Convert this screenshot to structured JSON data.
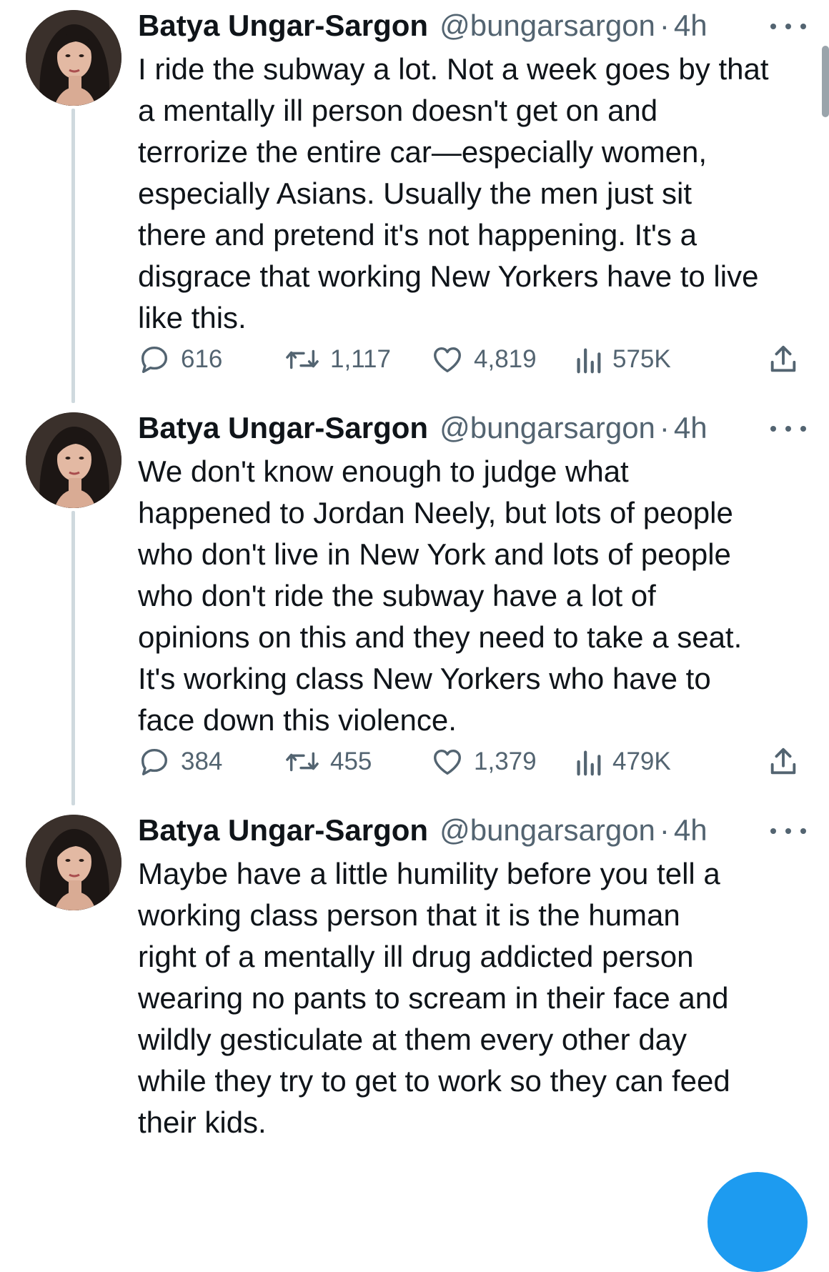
{
  "tweets": [
    {
      "display_name": "Batya Ungar-Sargon",
      "handle": "@bungarsargon",
      "separator": "·",
      "time": "4h",
      "text": "I ride the subway a lot. Not a week goes by that\na  mentally ill person doesn't get on and\nterrorize the entire car—especially women,\nespecially Asians. Usually the men just sit\nthere and pretend it's not happening. It's a\ndisgrace that working New Yorkers have to live\nlike this.",
      "replies": "616",
      "retweets": "1,117",
      "likes": "4,819",
      "views": "575K"
    },
    {
      "display_name": "Batya Ungar-Sargon",
      "handle": "@bungarsargon",
      "separator": "·",
      "time": "4h",
      "text": "We don't know enough to judge what\nhappened to Jordan Neely, but lots of people\nwho don't live in New York and lots of people\nwho don't ride the subway have a lot of\nopinions on this and they need to take a seat.\nIt's working class New Yorkers who have to\nface down this violence.",
      "replies": "384",
      "retweets": "455",
      "likes": "1,379",
      "views": "479K"
    },
    {
      "display_name": "Batya Ungar-Sargon",
      "handle": "@bungarsargon",
      "separator": "·",
      "time": "4h",
      "text": "Maybe have a little humility before you tell a\nworking class person that it is the human\nright of a mentally ill drug addicted person\nwearing no pants to scream in their face and\nwildly gesticulate at them every other day\nwhile they try to get to work so they can feed\ntheir kids."
    }
  ],
  "icons": {
    "reply": "speech-bubble-icon",
    "retweet": "retweet-arrows-icon",
    "like": "heart-icon",
    "views": "bar-chart-icon",
    "share": "share-upload-icon",
    "more": "more-dots-icon"
  },
  "colors": {
    "text_primary": "#0f1419",
    "text_secondary": "#536471",
    "thread_line": "#cfd9de",
    "accent_blue": "#1d9bf0"
  }
}
